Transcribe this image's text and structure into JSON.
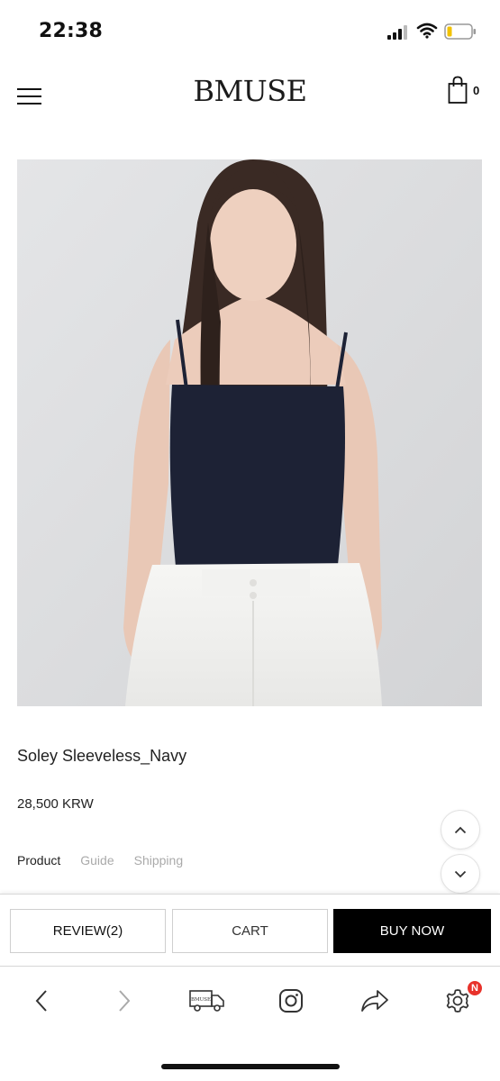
{
  "status_bar": {
    "time": "22:38"
  },
  "header": {
    "brand": "BMUSE",
    "cart_count": "0"
  },
  "product": {
    "name": "Soley Sleeveless_Navy",
    "price": "28,500 KRW",
    "tabs": [
      {
        "label": "Product",
        "active": true
      },
      {
        "label": "Guide",
        "active": false
      },
      {
        "label": "Shipping",
        "active": false
      }
    ],
    "image_alt": "Soley Sleeveless_Navy"
  },
  "actions": {
    "review_label": "REVIEW(2)",
    "cart_label": "CART",
    "buy_label": "BUY NOW"
  },
  "toolbar": {
    "items": [
      "chevron-left-icon",
      "chevron-right-icon",
      "delivery-truck-icon",
      "instagram-icon",
      "share-icon",
      "gear-icon"
    ],
    "truck_logo_text": "BMUSE",
    "badge": "N"
  },
  "colors": {
    "accent": "#000000",
    "badge": "#e8322b",
    "inactive_tab": "#aaaaaa"
  }
}
